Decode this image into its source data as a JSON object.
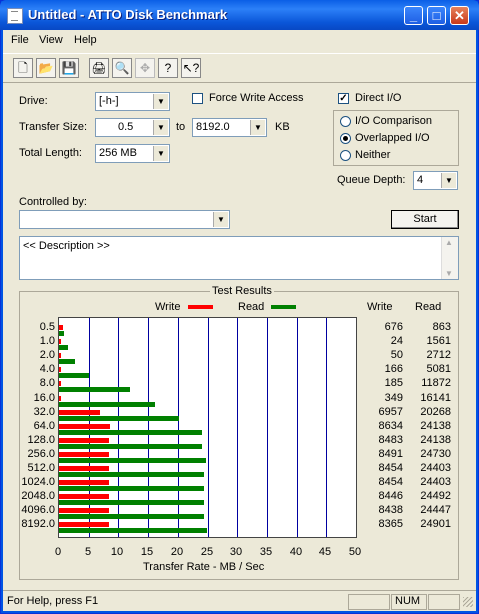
{
  "window": {
    "title": "Untitled - ATTO Disk Benchmark"
  },
  "menu": [
    "File",
    "View",
    "Help"
  ],
  "controls": {
    "drive_label": "Drive:",
    "drive_value": "[-h-]",
    "transfer_size_label": "Transfer Size:",
    "transfer_from": "0.5",
    "to_label": "to",
    "transfer_to": "8192.0",
    "kb_label": "KB",
    "total_length_label": "Total Length:",
    "total_length_value": "256 MB",
    "force_write_label": "Force Write Access",
    "force_write_checked": false,
    "direct_io_label": "Direct I/O",
    "direct_io_checked": true,
    "io_comparison_label": "I/O Comparison",
    "overlapped_io_label": "Overlapped I/O",
    "neither_label": "Neither",
    "selected_mode": "Overlapped I/O",
    "queue_depth_label": "Queue Depth:",
    "queue_depth_value": "4",
    "controlled_by_label": "Controlled by:",
    "controlled_by_value": "",
    "start_label": "Start",
    "description": "<< Description >>"
  },
  "results": {
    "group_title": "Test Results",
    "legend_write": "Write",
    "legend_read": "Read",
    "col_write": "Write",
    "col_read": "Read"
  },
  "chart_data": {
    "type": "bar",
    "orientation": "horizontal",
    "title": "Test Results",
    "xlabel": "Transfer Rate - MB / Sec",
    "xlim": [
      0,
      50
    ],
    "xticks": [
      "0",
      "5",
      "10",
      "15",
      "20",
      "25",
      "30",
      "35",
      "40",
      "45",
      "50"
    ],
    "categories": [
      "0.5",
      "1.0",
      "2.0",
      "4.0",
      "8.0",
      "16.0",
      "32.0",
      "64.0",
      "128.0",
      "256.0",
      "512.0",
      "1024.0",
      "2048.0",
      "4096.0",
      "8192.0"
    ],
    "series": [
      {
        "name": "Write",
        "color": "#ff0000",
        "values": [
          676,
          24,
          50,
          166,
          185,
          349,
          6957,
          8634,
          8483,
          8491,
          8454,
          8454,
          8446,
          8438,
          8365
        ]
      },
      {
        "name": "Read",
        "color": "#008000",
        "values": [
          863,
          1561,
          2712,
          5081,
          11872,
          16141,
          20268,
          24138,
          24138,
          24730,
          24403,
          24403,
          24492,
          24447,
          24901
        ]
      }
    ],
    "grid": true,
    "legend": "top"
  },
  "statusbar": {
    "help": "For Help, press F1",
    "num": "NUM"
  }
}
